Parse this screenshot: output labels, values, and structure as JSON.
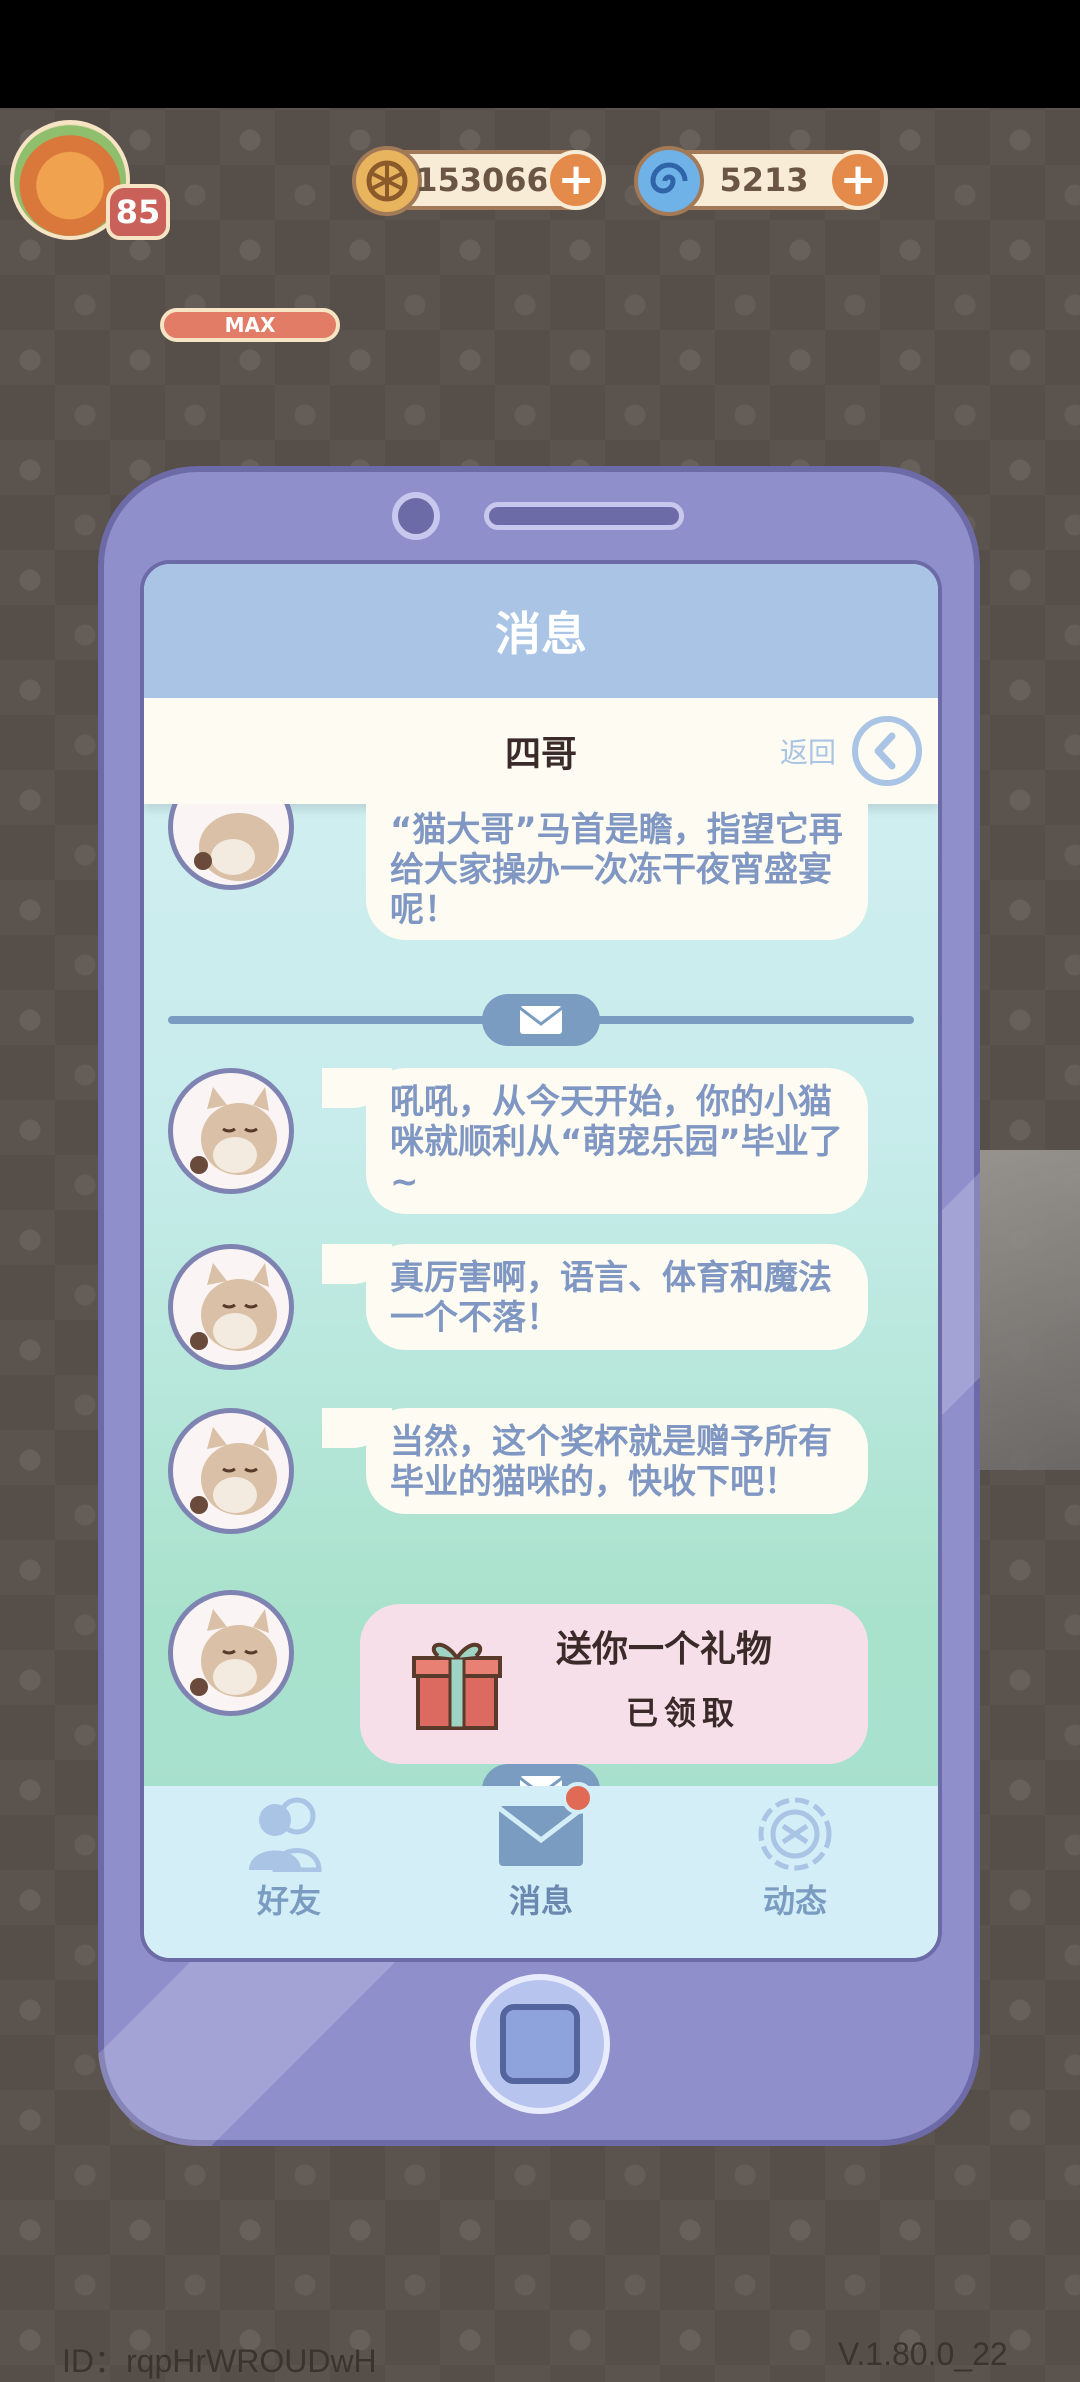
{
  "hud": {
    "level": "85",
    "level_status": "MAX",
    "coins": "153066",
    "gems": "5213"
  },
  "phone": {
    "title": "消息",
    "contact_name": "四哥",
    "back_label": "返回"
  },
  "messages": [
    "“猫大哥”马首是瞻，指望它再给大家操办一次冻干夜宵盛宴呢！",
    "吼吼，从今天开始，你的小猫咪就顺利从“萌宠乐园”毕业了~",
    "真厉害啊，语言、体育和魔法一个不落！",
    "当然，这个奖杯就是赠予所有毕业的猫咪的，快收下吧！"
  ],
  "gift": {
    "text": "送你一个礼物",
    "status": "已领取"
  },
  "tabs": {
    "friends": "好友",
    "messages": "消息",
    "moments": "动态"
  },
  "footer": {
    "id": "ID：rqpHrWROUDwH",
    "version": "V.1.80.0_22"
  },
  "colors": {
    "phone_body": "#8f8fcc",
    "title_bar": "#a9c4e4",
    "bubble_text": "#7f97c2",
    "notification": "#e06a55"
  }
}
